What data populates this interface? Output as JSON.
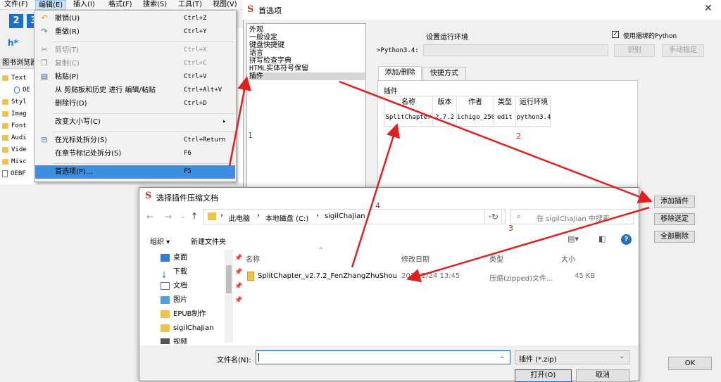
{
  "menubar": {
    "file": "文件(F)",
    "edit": "编辑(E)",
    "insert": "插入(I)",
    "format": "格式(F)",
    "search": "搜索(S)",
    "tools": "工具(T)",
    "view": "视图(V)"
  },
  "toolbar": {
    "btn2": "2",
    "btn3": "3",
    "heading": "h*"
  },
  "book_browser": {
    "title": "图书浏览器",
    "items": [
      "Text",
      "OE",
      "Styl",
      "Imag",
      "Font",
      "Audi",
      "Vide",
      "Misc",
      "OEBF"
    ]
  },
  "edit_menu": [
    {
      "label": "撤销(U)",
      "shortcut": "Ctrl+Z",
      "disabled": false,
      "icon": "undo-icon"
    },
    {
      "label": "重做(R)",
      "shortcut": "Ctrl+Y",
      "disabled": false,
      "icon": "redo-icon"
    },
    {
      "label": "剪切(T)",
      "shortcut": "Ctrl+X",
      "disabled": true,
      "icon": "cut-icon"
    },
    {
      "label": "复制(C)",
      "shortcut": "Ctrl+C",
      "disabled": true,
      "icon": "copy-icon"
    },
    {
      "label": "粘贴(P)",
      "shortcut": "Ctrl+V",
      "disabled": false,
      "icon": "paste-icon"
    },
    {
      "label": "从 剪贴板和历史 进行 编辑/粘贴",
      "shortcut": "Ctrl+Alt+V",
      "disabled": false,
      "icon": ""
    },
    {
      "label": "删除行(D)",
      "shortcut": "Ctrl+D",
      "disabled": false,
      "icon": ""
    },
    {
      "label": "改变大小写(C)",
      "shortcut": "▸",
      "disabled": false,
      "icon": ""
    },
    {
      "label": "在光标处拆分(S)",
      "shortcut": "Ctrl+Return",
      "disabled": false,
      "icon": "split-icon"
    },
    {
      "label": "在章节标记处拆分(S)",
      "shortcut": "F6",
      "disabled": false,
      "icon": ""
    },
    {
      "label": "首选项(P)...",
      "shortcut": "F5",
      "disabled": false,
      "icon": ""
    }
  ],
  "prefs": {
    "title": "首选项",
    "list": [
      "外观",
      "一般设定",
      "键盘快捷键",
      "语言",
      "拼写检查字典",
      "HTML实体符号保留",
      "插件"
    ],
    "selected_index": 6,
    "runtime_heading": "设置运行环境",
    "use_bundled_python": "使用捆绑的Python",
    "python_label": "Python3.4:",
    "identify_btn": "识别",
    "manual_btn": "手动指定",
    "tabs": [
      "添加/删除",
      "快捷方式"
    ],
    "plugins_label": "插件",
    "table_headers": [
      "名称",
      "版本",
      "作者",
      "类型",
      "运行环境"
    ],
    "table_row": [
      "SplitChapter",
      "2.7.2",
      "ichigo_250",
      "edit",
      "python3.4"
    ],
    "add_btn": "添加插件",
    "remove_btn": "移除选定",
    "remove_all_btn": "全部删除",
    "ok_btn": "OK"
  },
  "file_dialog": {
    "title": "选择插件压缩文档",
    "breadcrumb": [
      "此电脑",
      "本地磁盘 (C:)",
      "sigilChaJian"
    ],
    "search_placeholder": "在 sigilChaJian 中搜索",
    "organize": "组织 ▾",
    "new_folder": "新建文件夹",
    "sidebar": [
      "桌面",
      "下载",
      "文档",
      "图片",
      "EPUB制作",
      "sigilChaJian",
      "视频"
    ],
    "columns": [
      "名称",
      "修改日期",
      "类型",
      "大小"
    ],
    "file": {
      "name": "SplitChapter_v2.7.2_FenZhangZhuShou",
      "date": "2020/2/24 13:45",
      "type": "压缩(zipped)文件...",
      "size": "45 KB"
    },
    "filename_label": "文件名(N):",
    "filter": "插件 (*.zip)",
    "open_btn": "打开(O)",
    "cancel_btn": "取消"
  },
  "annotations": [
    "1",
    "2",
    "3",
    "4"
  ],
  "colors": {
    "arrow": "#e02020",
    "highlight": "#3d8ee1",
    "menu_active": "#cce4f7"
  }
}
